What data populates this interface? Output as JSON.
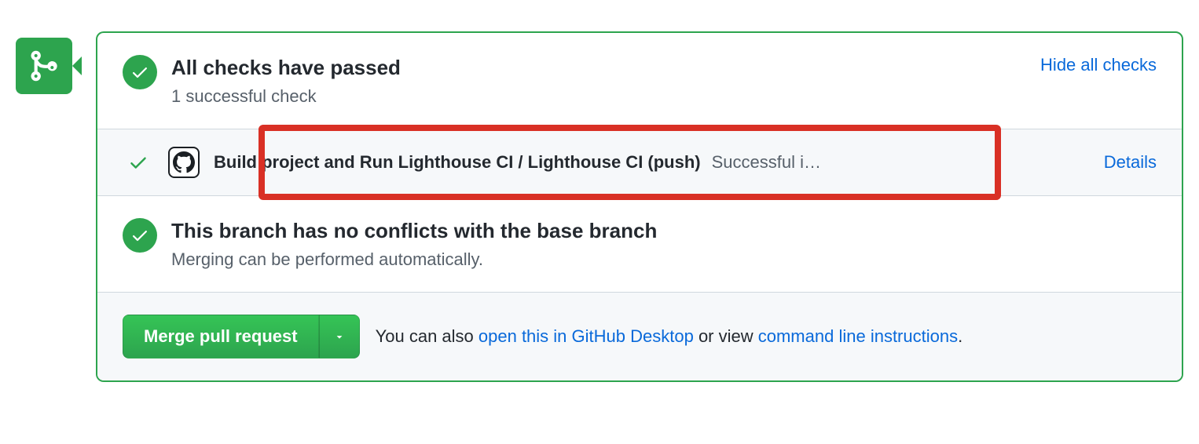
{
  "checks_summary": {
    "title": "All checks have passed",
    "subtitle": "1 successful check",
    "toggle_label": "Hide all checks"
  },
  "check_item": {
    "name": "Build project and Run Lighthouse CI / Lighthouse CI (push)",
    "status": "Successful i…",
    "details_label": "Details"
  },
  "conflicts": {
    "title": "This branch has no conflicts with the base branch",
    "subtitle": "Merging can be performed automatically."
  },
  "merge": {
    "button_label": "Merge pull request",
    "text_prefix": "You can also ",
    "link_desktop": "open this in GitHub Desktop",
    "text_middle": " or view ",
    "link_cli": "command line instructions",
    "text_suffix": "."
  }
}
